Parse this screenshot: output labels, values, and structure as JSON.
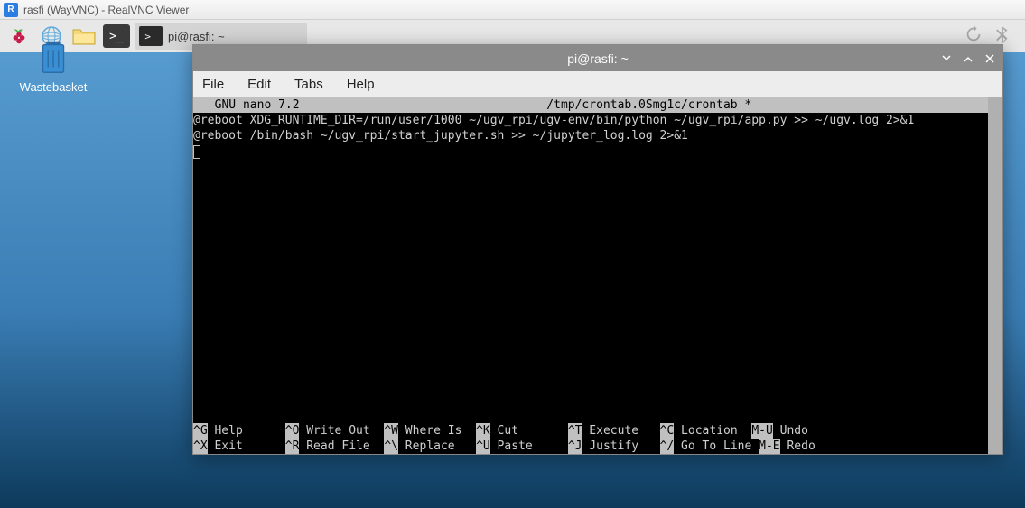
{
  "vnc": {
    "title": "rasfi (WayVNC) - RealVNC Viewer"
  },
  "task": {
    "label": "pi@rasfi: ~"
  },
  "desktop_icon": {
    "label": "Wastebasket"
  },
  "terminal": {
    "title": "pi@rasfi: ~",
    "menus": {
      "file": "File",
      "edit": "Edit",
      "tabs": "Tabs",
      "help": "Help"
    },
    "nano_header": {
      "left": "  GNU nano 7.2",
      "center": "/tmp/crontab.0Smg1c/crontab *",
      "right": ""
    },
    "content_lines": [
      "@reboot XDG_RUNTIME_DIR=/run/user/1000 ~/ugv_rpi/ugv-env/bin/python ~/ugv_rpi/app.py >> ~/ugv.log 2>&1",
      "@reboot /bin/bash ~/ugv_rpi/start_jupyter.sh >> ~/jupyter_log.log 2>&1"
    ],
    "shortcuts": {
      "r1": [
        {
          "k": "^G",
          "l": " Help      "
        },
        {
          "k": "^O",
          "l": " Write Out  "
        },
        {
          "k": "^W",
          "l": " Where Is  "
        },
        {
          "k": "^K",
          "l": " Cut       "
        },
        {
          "k": "^T",
          "l": " Execute   "
        },
        {
          "k": "^C",
          "l": " Location  "
        },
        {
          "k": "M-U",
          "l": " Undo"
        }
      ],
      "r2": [
        {
          "k": "^X",
          "l": " Exit      "
        },
        {
          "k": "^R",
          "l": " Read File  "
        },
        {
          "k": "^\\",
          "l": " Replace   "
        },
        {
          "k": "^U",
          "l": " Paste     "
        },
        {
          "k": "^J",
          "l": " Justify   "
        },
        {
          "k": "^/",
          "l": " Go To Line "
        },
        {
          "k": "M-E",
          "l": " Redo"
        }
      ]
    }
  }
}
